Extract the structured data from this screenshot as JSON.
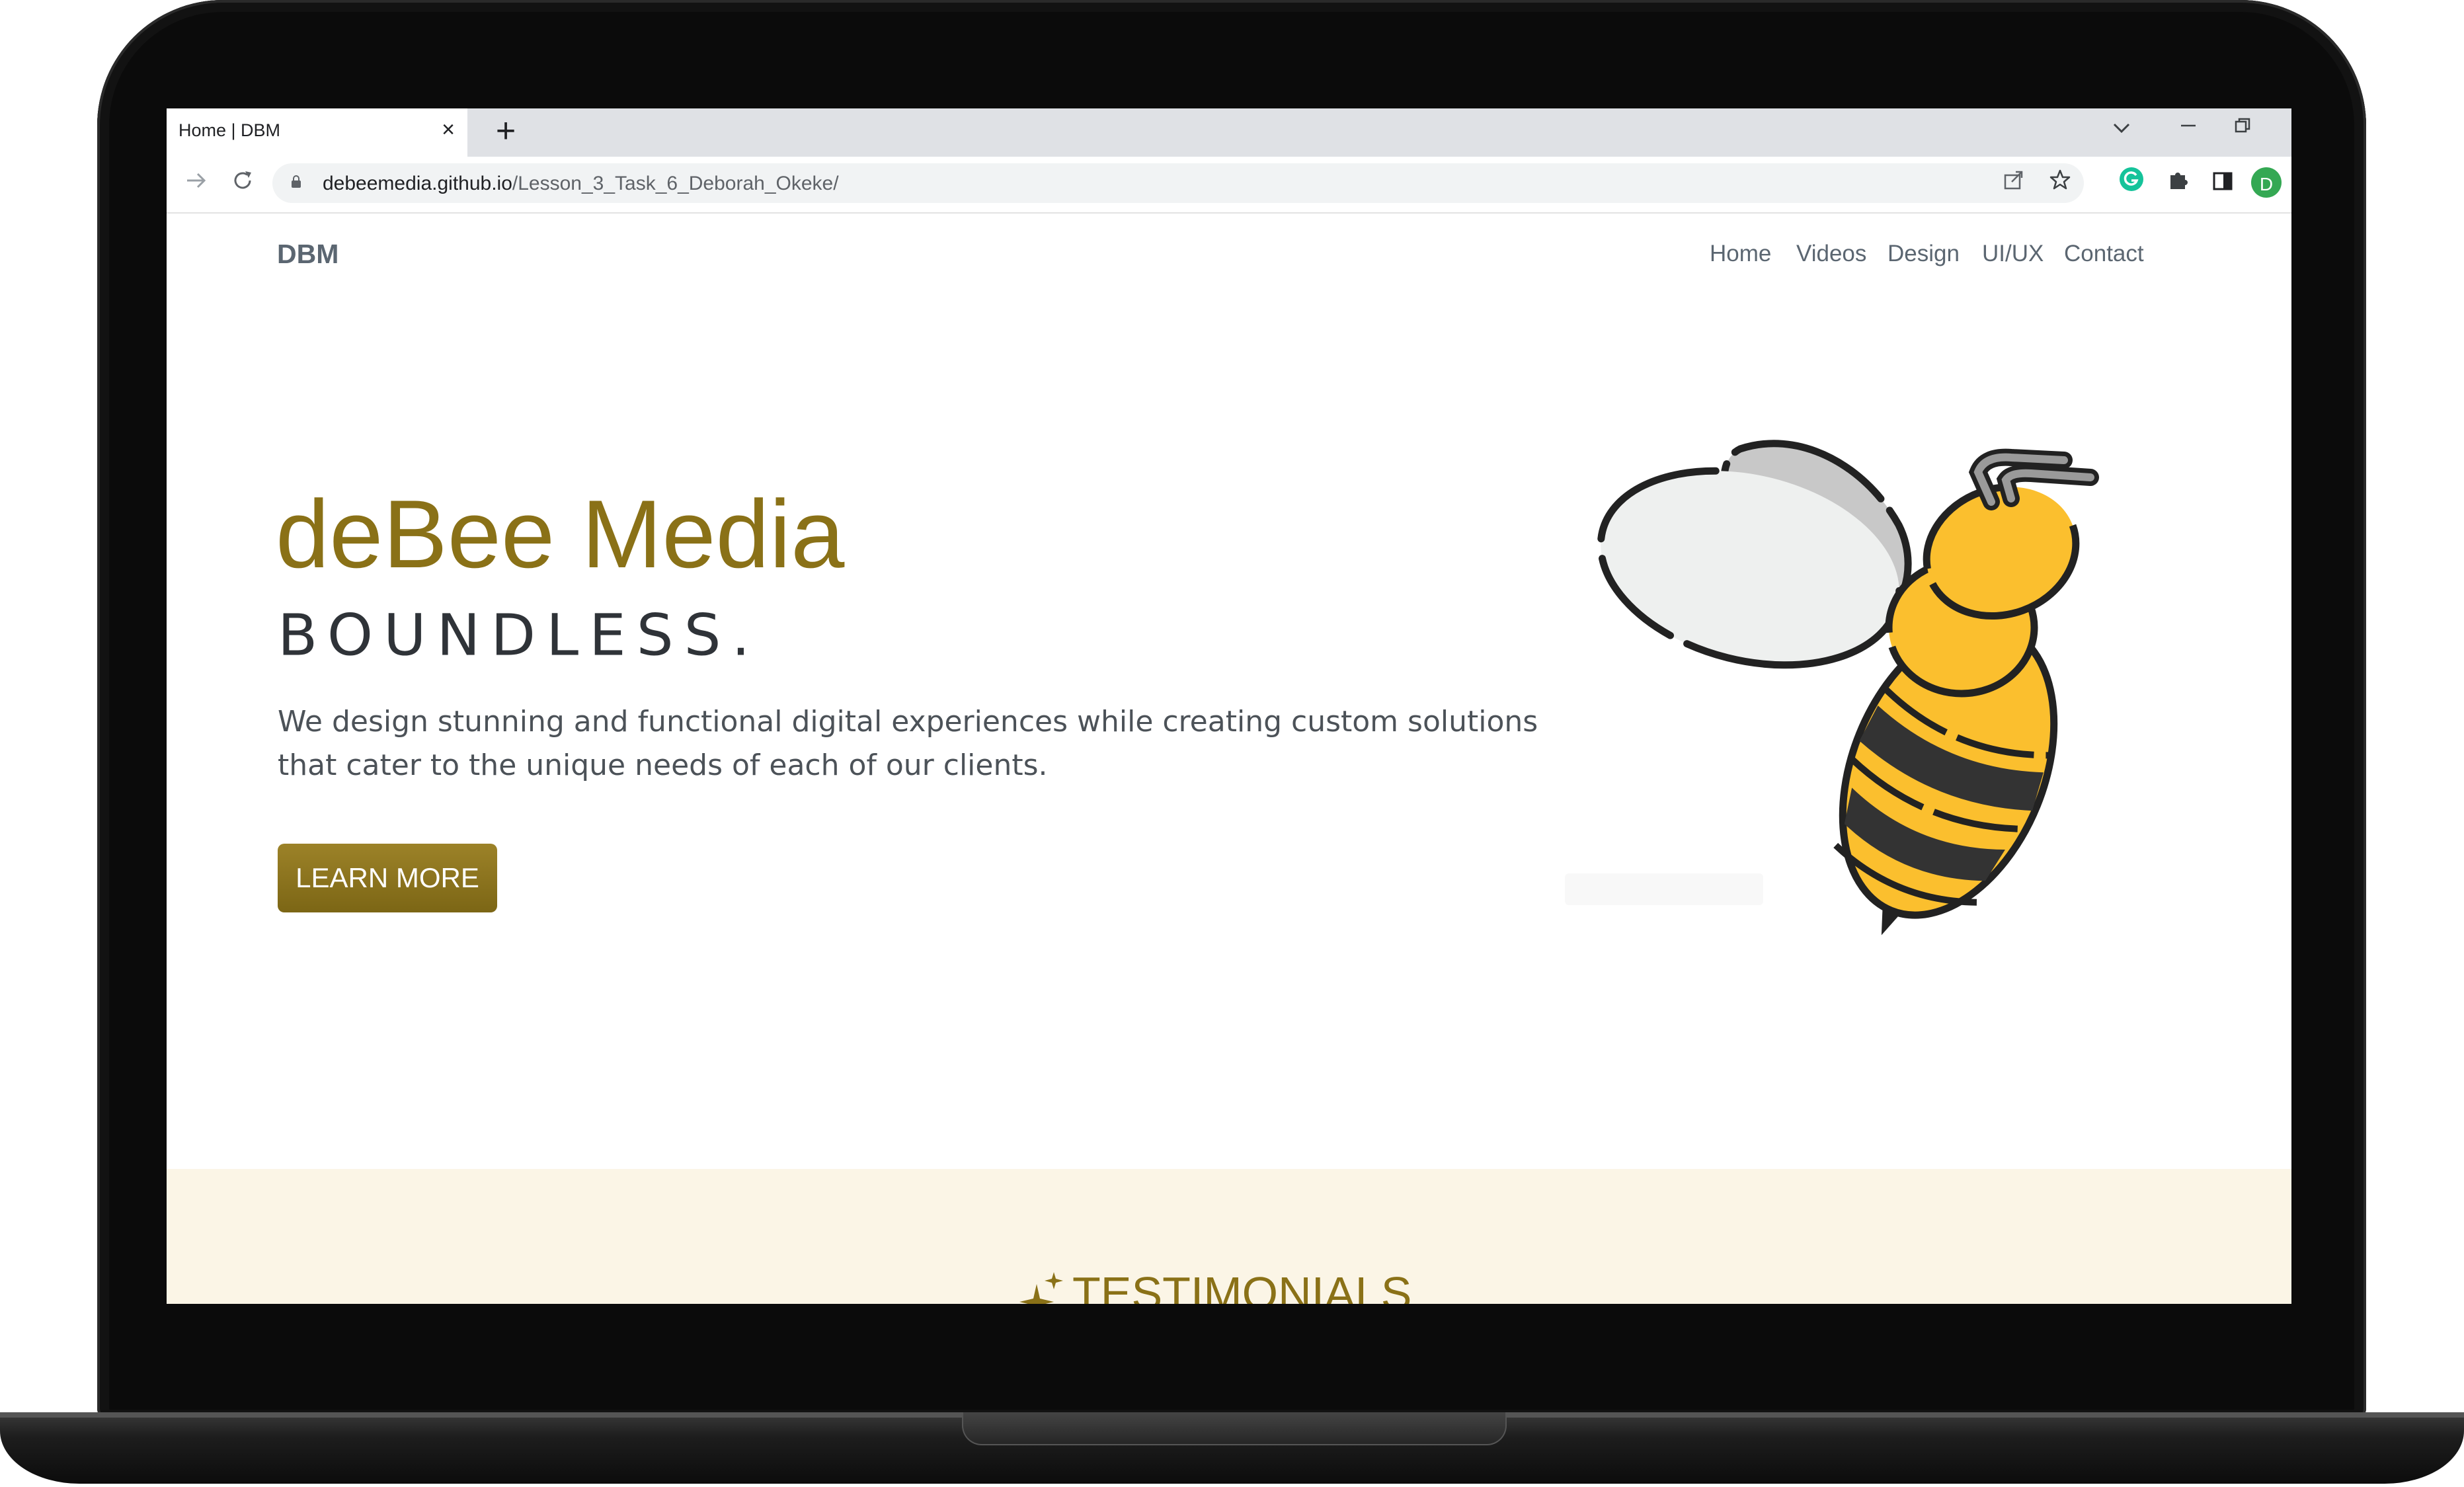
{
  "browser": {
    "tab_title": "Home | DBM",
    "tab_close": "×",
    "new_tab": "+",
    "url_host": "debeemedia.github.io",
    "url_path": "/Lesson_3_Task_6_Deborah_Okeke/",
    "profile_initial": "D"
  },
  "site": {
    "brand": "DBM",
    "nav": [
      "Home",
      "Videos",
      "Design",
      "UI/UX",
      "Contact"
    ]
  },
  "hero": {
    "title": "deBee Media",
    "subtitle": "BOUNDLESS.",
    "description": "We design stunning and functional digital experiences while creating custom solutions that cater to the unique needs of each of our clients.",
    "cta": "LEARN MORE"
  },
  "testimonials": {
    "title": "TESTIMONIALS"
  },
  "colors": {
    "accent": "#8a7117",
    "band": "#fbf5e6",
    "bee_yellow": "#fbbf2e",
    "bee_dark": "#333333",
    "wing": "#eef0ef"
  }
}
